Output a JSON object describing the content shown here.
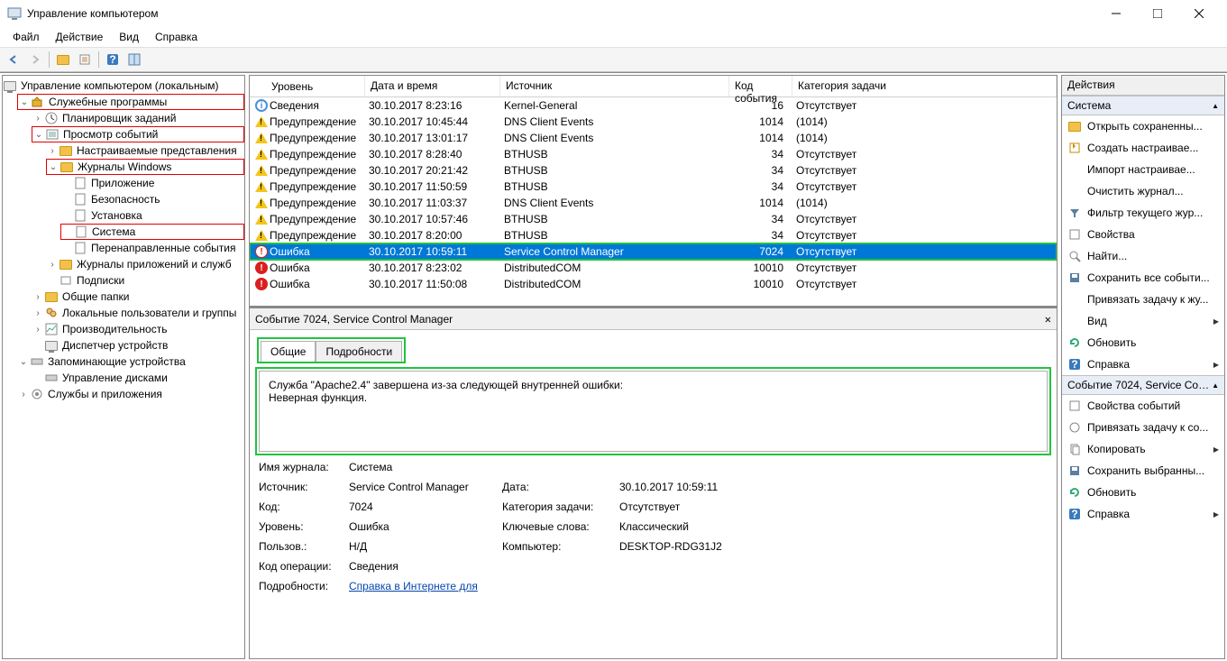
{
  "window": {
    "title": "Управление компьютером"
  },
  "menu": {
    "file": "Файл",
    "action": "Действие",
    "view": "Вид",
    "help": "Справка"
  },
  "tree": {
    "root": "Управление компьютером (локальным)",
    "utilities": "Служебные программы",
    "scheduler": "Планировщик заданий",
    "eventviewer": "Просмотр событий",
    "customviews": "Настраиваемые представления",
    "winlogs": "Журналы Windows",
    "app": "Приложение",
    "security": "Безопасность",
    "setup": "Установка",
    "system": "Система",
    "forwarded": "Перенаправленные события",
    "applogs": "Журналы приложений и служб",
    "subscriptions": "Подписки",
    "sharedfolders": "Общие папки",
    "localusers": "Локальные пользователи и группы",
    "performance": "Производительность",
    "devicemgr": "Диспетчер устройств",
    "storage": "Запоминающие устройства",
    "diskmgr": "Управление дисками",
    "services": "Службы и приложения"
  },
  "columns": {
    "level": "Уровень",
    "date": "Дата и время",
    "source": "Источник",
    "id": "Код события",
    "category": "Категория задачи"
  },
  "levels": {
    "info": "Сведения",
    "warning": "Предупреждение",
    "error": "Ошибка"
  },
  "events": [
    {
      "level": "info",
      "date": "30.10.2017 8:23:16",
      "source": "Kernel-General",
      "id": "16",
      "category": "Отсутствует"
    },
    {
      "level": "warning",
      "date": "30.10.2017 10:45:44",
      "source": "DNS Client Events",
      "id": "1014",
      "category": "(1014)"
    },
    {
      "level": "warning",
      "date": "30.10.2017 13:01:17",
      "source": "DNS Client Events",
      "id": "1014",
      "category": "(1014)"
    },
    {
      "level": "warning",
      "date": "30.10.2017 8:28:40",
      "source": "BTHUSB",
      "id": "34",
      "category": "Отсутствует"
    },
    {
      "level": "warning",
      "date": "30.10.2017 20:21:42",
      "source": "BTHUSB",
      "id": "34",
      "category": "Отсутствует"
    },
    {
      "level": "warning",
      "date": "30.10.2017 11:50:59",
      "source": "BTHUSB",
      "id": "34",
      "category": "Отсутствует"
    },
    {
      "level": "warning",
      "date": "30.10.2017 11:03:37",
      "source": "DNS Client Events",
      "id": "1014",
      "category": "(1014)"
    },
    {
      "level": "warning",
      "date": "30.10.2017 10:57:46",
      "source": "BTHUSB",
      "id": "34",
      "category": "Отсутствует"
    },
    {
      "level": "warning",
      "date": "30.10.2017 8:20:00",
      "source": "BTHUSB",
      "id": "34",
      "category": "Отсутствует"
    },
    {
      "level": "error",
      "date": "30.10.2017 10:59:11",
      "source": "Service Control Manager",
      "id": "7024",
      "category": "Отсутствует",
      "selected": true,
      "highlighted": true
    },
    {
      "level": "error",
      "date": "30.10.2017 8:23:02",
      "source": "DistributedCOM",
      "id": "10010",
      "category": "Отсутствует"
    },
    {
      "level": "error",
      "date": "30.10.2017 11:50:08",
      "source": "DistributedCOM",
      "id": "10010",
      "category": "Отсутствует"
    }
  ],
  "detail": {
    "title": "Событие 7024, Service Control Manager",
    "tab_general": "Общие",
    "tab_details": "Подробности",
    "message_line1": "Служба \"Apache2.4\" завершена из-за следующей внутренней ошибки:",
    "message_line2": "Неверная функция.",
    "props": {
      "logname_k": "Имя журнала:",
      "logname_v": "Система",
      "source_k": "Источник:",
      "source_v": "Service Control Manager",
      "date_k": "Дата:",
      "date_v": "30.10.2017 10:59:11",
      "code_k": "Код:",
      "code_v": "7024",
      "category_k": "Категория задачи:",
      "category_v": "Отсутствует",
      "level_k": "Уровень:",
      "level_v": "Ошибка",
      "keywords_k": "Ключевые слова:",
      "keywords_v": "Классический",
      "user_k": "Пользов.:",
      "user_v": "Н/Д",
      "computer_k": "Компьютер:",
      "computer_v": "DESKTOP-RDG31J2",
      "opcode_k": "Код операции:",
      "opcode_v": "Сведения",
      "moreinfo_k": "Подробности:",
      "moreinfo_v": "Справка в Интернете для "
    }
  },
  "actions": {
    "header": "Действия",
    "section1": "Система",
    "open_saved": "Открыть сохраненны...",
    "create_custom": "Создать настраивае...",
    "import_custom": "Импорт настраивае...",
    "clear_log": "Очистить журнал...",
    "filter": "Фильтр текущего жур...",
    "properties": "Свойства",
    "find": "Найти...",
    "save_all": "Сохранить все событи...",
    "attach_task": "Привязать задачу к жу...",
    "view": "Вид",
    "refresh": "Обновить",
    "help": "Справка",
    "section2": "Событие 7024, Service Con...",
    "event_props": "Свойства событий",
    "attach_task2": "Привязать задачу к со...",
    "copy": "Копировать",
    "save_selected": "Сохранить выбранны...",
    "refresh2": "Обновить",
    "help2": "Справка"
  }
}
